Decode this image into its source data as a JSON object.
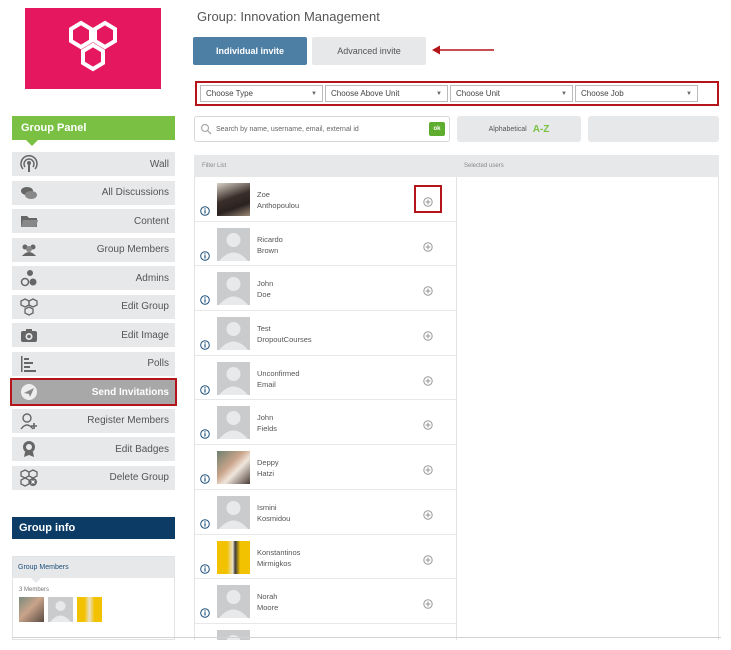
{
  "page": {
    "title": "Group: Innovation Management"
  },
  "colors": {
    "accent_green": "#7ac143",
    "brand_pink": "#e5175f",
    "primary_blue": "#4d7fa4",
    "highlight_red": "#b3151b",
    "info_navy": "#0c3c66"
  },
  "sidebar": {
    "panel_title": "Group Panel",
    "items": [
      {
        "label": "Wall",
        "icon": "wall-icon"
      },
      {
        "label": "All Discussions",
        "icon": "discussions-icon"
      },
      {
        "label": "Content",
        "icon": "folder-icon"
      },
      {
        "label": "Group Members",
        "icon": "members-icon"
      },
      {
        "label": "Admins",
        "icon": "admins-icon"
      },
      {
        "label": "Edit Group",
        "icon": "edit-group-icon"
      },
      {
        "label": "Edit Image",
        "icon": "edit-image-icon"
      },
      {
        "label": "Polls",
        "icon": "polls-icon"
      },
      {
        "label": "Send Invitations",
        "icon": "send-invitations-icon",
        "active": true
      },
      {
        "label": "Register Members",
        "icon": "register-member-icon"
      },
      {
        "label": "Edit Badges",
        "icon": "badge-icon"
      },
      {
        "label": "Delete Group",
        "icon": "delete-group-icon"
      }
    ],
    "info_title": "Group info",
    "members_tab": "Group Members",
    "members_count": "3 Members"
  },
  "invite": {
    "individual_label": "Individual invite",
    "advanced_label": "Advanced invite"
  },
  "filters": [
    {
      "label": "Choose Type"
    },
    {
      "label": "Choose Above Unit"
    },
    {
      "label": "Choose Unit"
    },
    {
      "label": "Choose Job"
    }
  ],
  "search": {
    "placeholder": "Search by name, username, email, external id",
    "ok_label": "ok"
  },
  "sort": {
    "label": "Alphabetical",
    "az": "A-Z"
  },
  "list": {
    "filter_header": "Filter List",
    "selected_header": "Selected users",
    "users": [
      {
        "first": "Zoe",
        "last": "Anthopoulou"
      },
      {
        "first": "Ricardo",
        "last": "Brown"
      },
      {
        "first": "John",
        "last": "Doe"
      },
      {
        "first": "Test",
        "last": "DropoutCourses"
      },
      {
        "first": "Unconfirmed",
        "last": "Email"
      },
      {
        "first": "John",
        "last": "Fields"
      },
      {
        "first": "Deppy",
        "last": "Hatzi"
      },
      {
        "first": "Ismini",
        "last": "Kosmidou"
      },
      {
        "first": "Konstantinos",
        "last": "Mirmigkos"
      },
      {
        "first": "Norah",
        "last": "Moore"
      }
    ]
  }
}
